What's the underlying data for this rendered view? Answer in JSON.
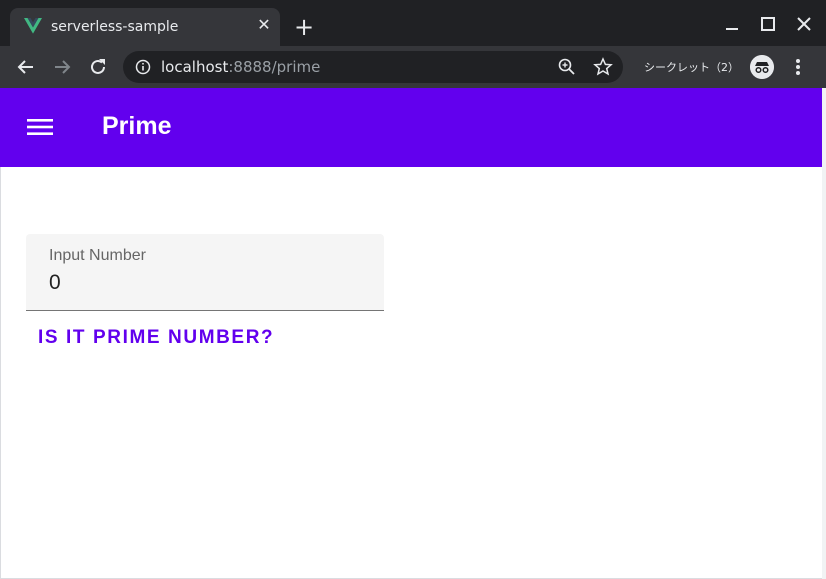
{
  "browser": {
    "tab_title": "serverless-sample",
    "url_host": "localhost",
    "url_rest": ":8888/prime",
    "incognito_label": "シークレット（2）",
    "new_tab_glyph": "+",
    "close_glyph": "✕",
    "colors": {
      "chrome_bg": "#202124",
      "toolbar_bg": "#35363a",
      "vue_green": "#41b883",
      "vue_dark": "#35495e"
    },
    "icons": [
      "vue-logo-icon",
      "close-icon",
      "plus-icon",
      "minimize-icon",
      "maximize-icon",
      "window-close-icon",
      "back-arrow-icon",
      "forward-arrow-icon",
      "reload-icon",
      "info-icon",
      "zoom-icon",
      "star-icon",
      "incognito-icon",
      "more-vert-icon"
    ]
  },
  "app": {
    "title": "Prime",
    "primary_color": "#6200ee",
    "menu_icon": "hamburger-menu-icon"
  },
  "form": {
    "input_label": "Input Number",
    "input_value": "0",
    "button_label": "IS IT PRIME NUMBER?"
  }
}
